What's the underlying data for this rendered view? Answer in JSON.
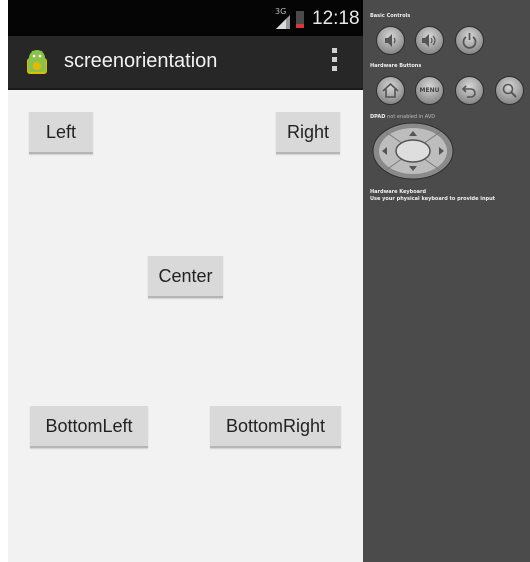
{
  "status_bar": {
    "network_type": "3G",
    "time": "12:18"
  },
  "action_bar": {
    "app_title": "screenorientation",
    "app_icon": "android-icon",
    "overflow_icon": "overflow-menu-icon"
  },
  "buttons": {
    "left": "Left",
    "right": "Right",
    "center": "Center",
    "bottom_left": "BottomLeft",
    "bottom_right": "BottomRight"
  },
  "emulator_controls": {
    "basic_controls_label": "Basic Controls",
    "basic_controls": [
      {
        "icon": "volume-down-icon"
      },
      {
        "icon": "volume-up-icon"
      },
      {
        "icon": "power-icon"
      }
    ],
    "hardware_buttons_label": "Hardware Buttons",
    "hardware_buttons": [
      {
        "icon": "home-icon"
      },
      {
        "icon": "menu-button",
        "label": "MENU"
      },
      {
        "icon": "back-icon"
      },
      {
        "icon": "search-icon"
      }
    ],
    "dpad_label": "DPAD",
    "dpad_note": "not enabled in AVD",
    "keyboard_label": "Hardware Keyboard",
    "keyboard_note": "Use your physical keyboard to provide input"
  },
  "colors": {
    "status_bar": "#050505",
    "action_bar": "#272727",
    "screen_background": "#f2f2f2",
    "button": "#d9d9d9",
    "controls_panel": "#4b4b4b",
    "battery_low": "#d23a3a"
  }
}
